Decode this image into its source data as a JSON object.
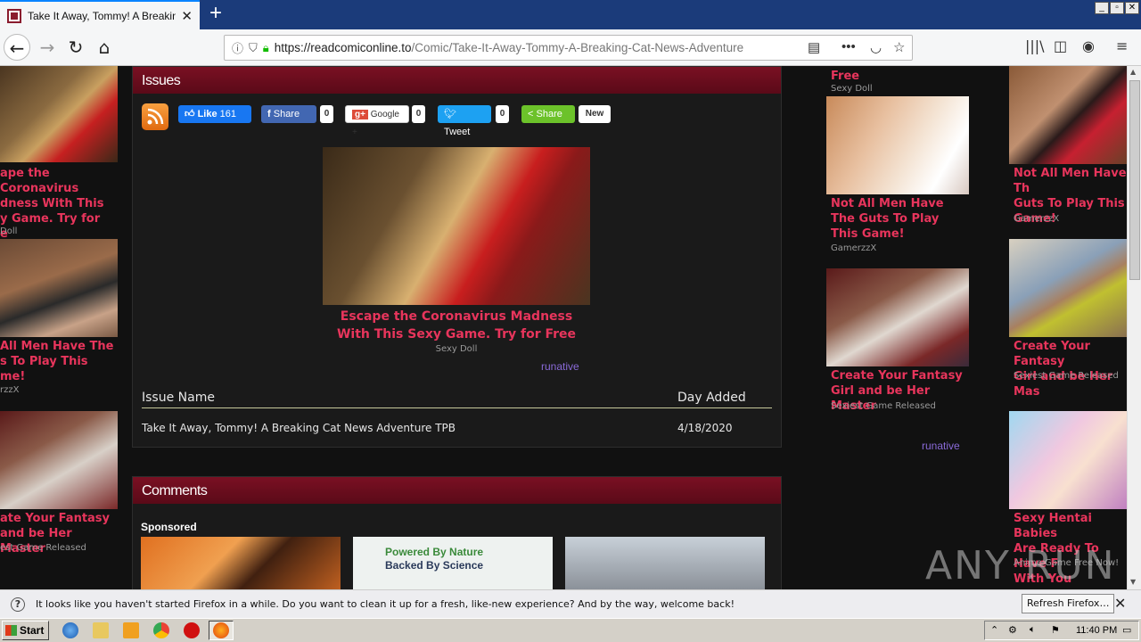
{
  "browser": {
    "tab_title": "Take It Away, Tommy! A Breaking Cat News Adventure",
    "new_tab_label": "+",
    "url_host": "https://readcomiconline.to",
    "url_path": "/Comic/Take-It-Away-Tommy-A-Breaking-Cat-News-Adventure",
    "window_min": "_",
    "window_max": "▫",
    "window_close": "✕"
  },
  "left_ads": [
    {
      "title": "Escape the Coronavirus Madness With This Sexy Game. Try for Free",
      "source": "Sexy Doll"
    },
    {
      "title": "Not All Men Have The Guts To Play This Game!",
      "source": "GamerzzX"
    },
    {
      "title": "Create Your Fantasy Girl and be Her Master",
      "source": "Sexiest Game Released"
    }
  ],
  "left_ads_visible": [
    {
      "title": "ape the Coronavirus\ndness With This\ny Game. Try for\ne",
      "source": "Doll"
    },
    {
      "title": "All Men Have The\ns To Play This\nme!",
      "source": "rzzX"
    },
    {
      "title": "ate Your Fantasy\nand be Her Master",
      "source": "est Game Released"
    }
  ],
  "issues": {
    "header": "Issues",
    "share": {
      "like_label": "Like",
      "like_count": "161",
      "fb_share_label": "Share",
      "fb_count": "0",
      "google_label": "Google +",
      "google_count": "0",
      "tweet_label": "Tweet",
      "tweet_count": "0",
      "share_label": "Share",
      "new_label": "New"
    },
    "ad": {
      "title": "Escape the Coronavirus Madness With This Sexy Game. Try for Free",
      "source": "Sexy Doll",
      "brand": "runative"
    },
    "table": {
      "col_name": "Issue Name",
      "col_date": "Day Added",
      "rows": [
        {
          "name": "Take It Away, Tommy! A Breaking Cat News Adventure TPB",
          "date": "4/18/2020"
        }
      ]
    }
  },
  "comments": {
    "header": "Comments",
    "sponsored_label": "Sponsored",
    "sponsored_ad2_line1": "Powered By Nature",
    "sponsored_ad2_line2": "Backed By Science"
  },
  "right_ads_col1": [
    {
      "title": "Free",
      "source": "Sexy Doll"
    },
    {
      "title": "Not All Men Have The Guts To Play This Game!",
      "source": "GamerzzX"
    },
    {
      "title": "Create Your Fantasy Girl and be Her Master",
      "source": "Sexiest Game Released"
    },
    {
      "brand": "runative"
    }
  ],
  "right_ads_col2": [
    {
      "title": "Not All Men Have Th\nGuts To Play This\nGame!",
      "source": "GamerzzX"
    },
    {
      "title": "Create Your Fantasy\nGirl and be Her Mas",
      "source": "Sexiest Game Released"
    },
    {
      "title": "Sexy Hentai Babies\nAre Ready To Have F\nWith You",
      "source": "Anime Game Free Now!"
    }
  ],
  "watermark": "ANY RUN",
  "notification": {
    "text": "It looks like you haven't started Firefox in a while. Do you want to clean it up for a fresh, like-new experience? And by the way, welcome back!",
    "button": "Refresh Firefox…"
  },
  "taskbar": {
    "start_label": "Start",
    "clock": "11:40 PM"
  }
}
